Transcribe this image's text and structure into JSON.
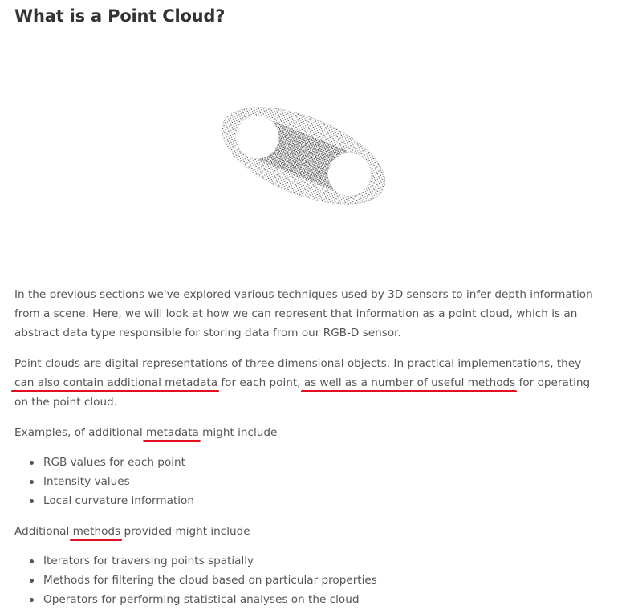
{
  "title": "What is a Point Cloud?",
  "paragraphs": {
    "p1": "In the previous sections we've explored various techniques used by 3D sensors to infer depth information from a scene. Here, we will look at how we can represent that information as a point cloud, which is an abstract data type responsible for storing data from our RGB-D sensor.",
    "p2": {
      "a": "Point clouds are digital representations of three dimensional objects. In practical implementations, they ",
      "b": "can also contain additional metadata",
      "c": " for each point, ",
      "d": "as well as a number of useful methods",
      "e": " for operating on the point cloud."
    },
    "p3": {
      "a": "Examples, of additional ",
      "b": "metadata",
      "c": " might include"
    },
    "p4": {
      "a": "Additional ",
      "b": "methods",
      "c": " provided might include"
    }
  },
  "metadata_items": [
    "RGB values for each point",
    "Intensity values",
    "Local curvature information"
  ],
  "method_items": [
    "Iterators for traversing points spatially",
    "Methods for filtering the cloud based on particular properties",
    "Operators for performing statistical analyses on the cloud"
  ],
  "colors": {
    "underline": "#e0101e",
    "text": "#555555",
    "heading": "#333333"
  }
}
